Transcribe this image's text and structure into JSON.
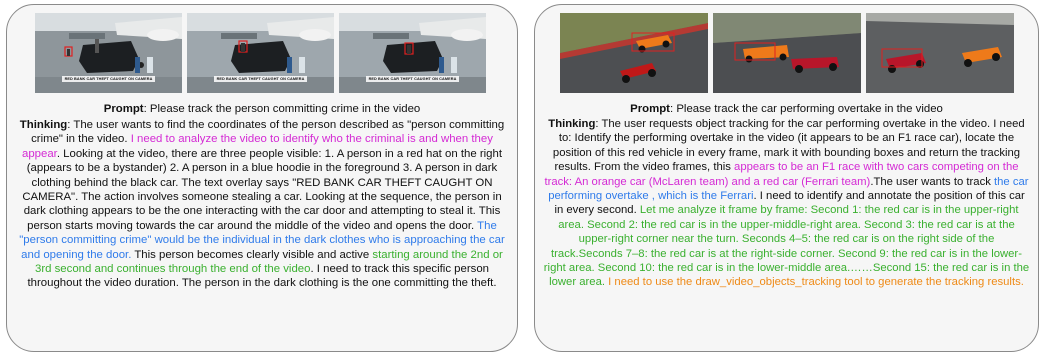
{
  "left": {
    "frames": [
      {
        "overlay": "RED BANK CAR THEFT CAUGHT ON CAMERA"
      },
      {
        "overlay": "RED BANK CAR THEFT CAUGHT ON CAMERA"
      },
      {
        "overlay": "RED BANK CAR THEFT CAUGHT ON CAMERA"
      }
    ],
    "prompt_label": "Prompt",
    "prompt_text": ": Please track the person committing crime in the video",
    "thinking_label": "Thinking",
    "t1": ": The user wants to find the coordinates of the person described as \"person committing crime\" in the video. ",
    "t2": "I need to analyze the video to identify who the criminal is and when they appear",
    "t3": ". Looking at the video, there are three people visible: 1. A person in a red hat on the right (appears to be a bystander) 2. A person in a blue hoodie in the foreground 3. A person in dark clothing behind the black car. The text overlay says \"RED BANK CAR THEFT CAUGHT ON CAMERA\". The action involves someone stealing a car. Looking at the sequence, the person in dark clothing appears to be the one interacting with the car door and attempting to steal it. This person starts moving towards the car around the middle of the video and opens the door. ",
    "t4": "The \"person committing crime\" would be the individual in the dark clothes who is approaching the car and opening the door.",
    "t5": " This person becomes clearly visible and active ",
    "t6": "starting around the 2nd or 3rd second and continues through the end of the video",
    "t7": ". I need to track this specific person throughout the video duration. The person in the dark clothing is the one committing the theft."
  },
  "right": {
    "prompt_label": "Prompt",
    "prompt_text": ": Please track the car performing overtake in the video",
    "thinking_label": "Thinking",
    "t1": ": The user requests object tracking for the car performing overtake in the video. I need to: Identify the performing overtake in the video (it appears to be an F1 race car), locate the position of this red vehicle in every frame, mark it with bounding boxes and return the tracking results. From the video frames, this ",
    "t2": "appears to be an F1 race with two cars competing on the track: An orange car (McLaren team) and a red car (Ferrari team)",
    "t3": ".The user wants to track ",
    "t4": "the car performing overtake , which is the Ferrari",
    "t5": ". I need to identify and annotate the position of this car in every second. ",
    "t6": "Let me analyze it frame by frame: Second 1: the red car is in the upper-right area. Second 2: the red car is in the upper-middle-right area. Second 3: the red car is at the upper-right corner near the turn. Seconds 4–5: the red car is on the right side of the track.Seconds 7–8: the red car is at the right-side corner. Second 9: the red car is in the lower-right area. Second 10: the red car is in the lower-middle area.……Second 15: the red car is in the lower area.",
    "t7": " I need to use the draw_video_objects_tracking tool to generate the tracking results."
  },
  "colors": {
    "highlight_magenta": "#d42ad4",
    "highlight_blue": "#2f7bea",
    "highlight_green": "#3ab02f",
    "highlight_orange": "#ee8a17",
    "bbox_red": "#e02020"
  }
}
